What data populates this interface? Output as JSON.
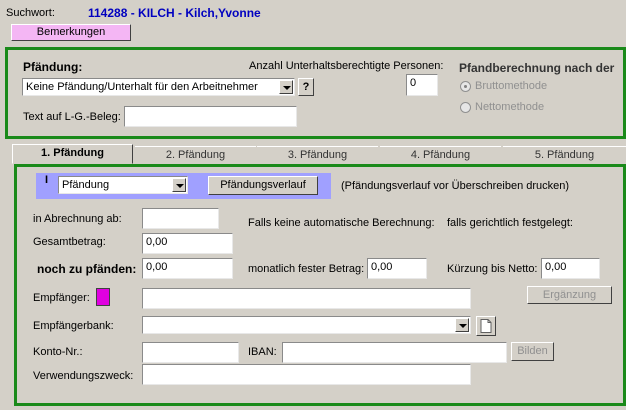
{
  "header": {
    "search_label": "Suchwort:",
    "search_value": "114288 - KILCH - Kilch,Yvonne",
    "remarks_button": "Bemerkungen"
  },
  "pfaendung_section": {
    "title": "Pfändung:",
    "type_select": "Keine Pfändung/Unterhalt für den Arbeitnehmer",
    "help_button": "?",
    "persons_label": "Anzahl Unterhaltsberechtigte Personen:",
    "persons_value": "0",
    "text_label": "Text auf L-G.-Beleg:",
    "text_value": "",
    "calc_title": "Pfandberechnung nach der",
    "radio_brutto": "Bruttomethode",
    "radio_netto": "Nettomethode"
  },
  "tabs": [
    {
      "label": "1. Pfändung",
      "active": true
    },
    {
      "label": "2. Pfändung",
      "active": false
    },
    {
      "label": "3. Pfändung",
      "active": false
    },
    {
      "label": "4. Pfändung",
      "active": false
    },
    {
      "label": "5. Pfändung",
      "active": false
    }
  ],
  "detail": {
    "marker": "I",
    "kind_select": "Pfändung",
    "history_button": "Pfändungsverlauf",
    "history_note": "(Pfändungsverlauf vor Überschreiben drucken)",
    "billing_label": "in Abrechnung  ab:",
    "billing_value": "",
    "auto_calc_label": "Falls keine automatische Berechnung:",
    "court_label": "falls gerichtlich festgelegt:",
    "total_label": "Gesamtbetrag:",
    "total_value": "0,00",
    "remaining_label": "noch zu pfänden:",
    "remaining_value": "0,00",
    "monthly_label": "monatlich fester Betrag:",
    "monthly_value": "0,00",
    "reduction_label": "Kürzung bis Netto:",
    "reduction_value": "0,00",
    "recipient_label": "Empfänger:",
    "recipient_value": "",
    "supplement_button": "Ergänzung",
    "bank_label": "Empfängerbank:",
    "bank_value": "",
    "account_label": "Konto-Nr.:",
    "account_value": "",
    "iban_label": "IBAN:",
    "iban_value": "",
    "build_button": "Bilden",
    "purpose_label": "Verwendungszweck:",
    "purpose_value": ""
  },
  "colors": {
    "green_border": "#1a8a1a",
    "blue_text": "#0000c0",
    "pink_button": "#f4b6f4",
    "magenta_swatch": "#e000e0",
    "lavender_bar": "#a0a0ff"
  }
}
